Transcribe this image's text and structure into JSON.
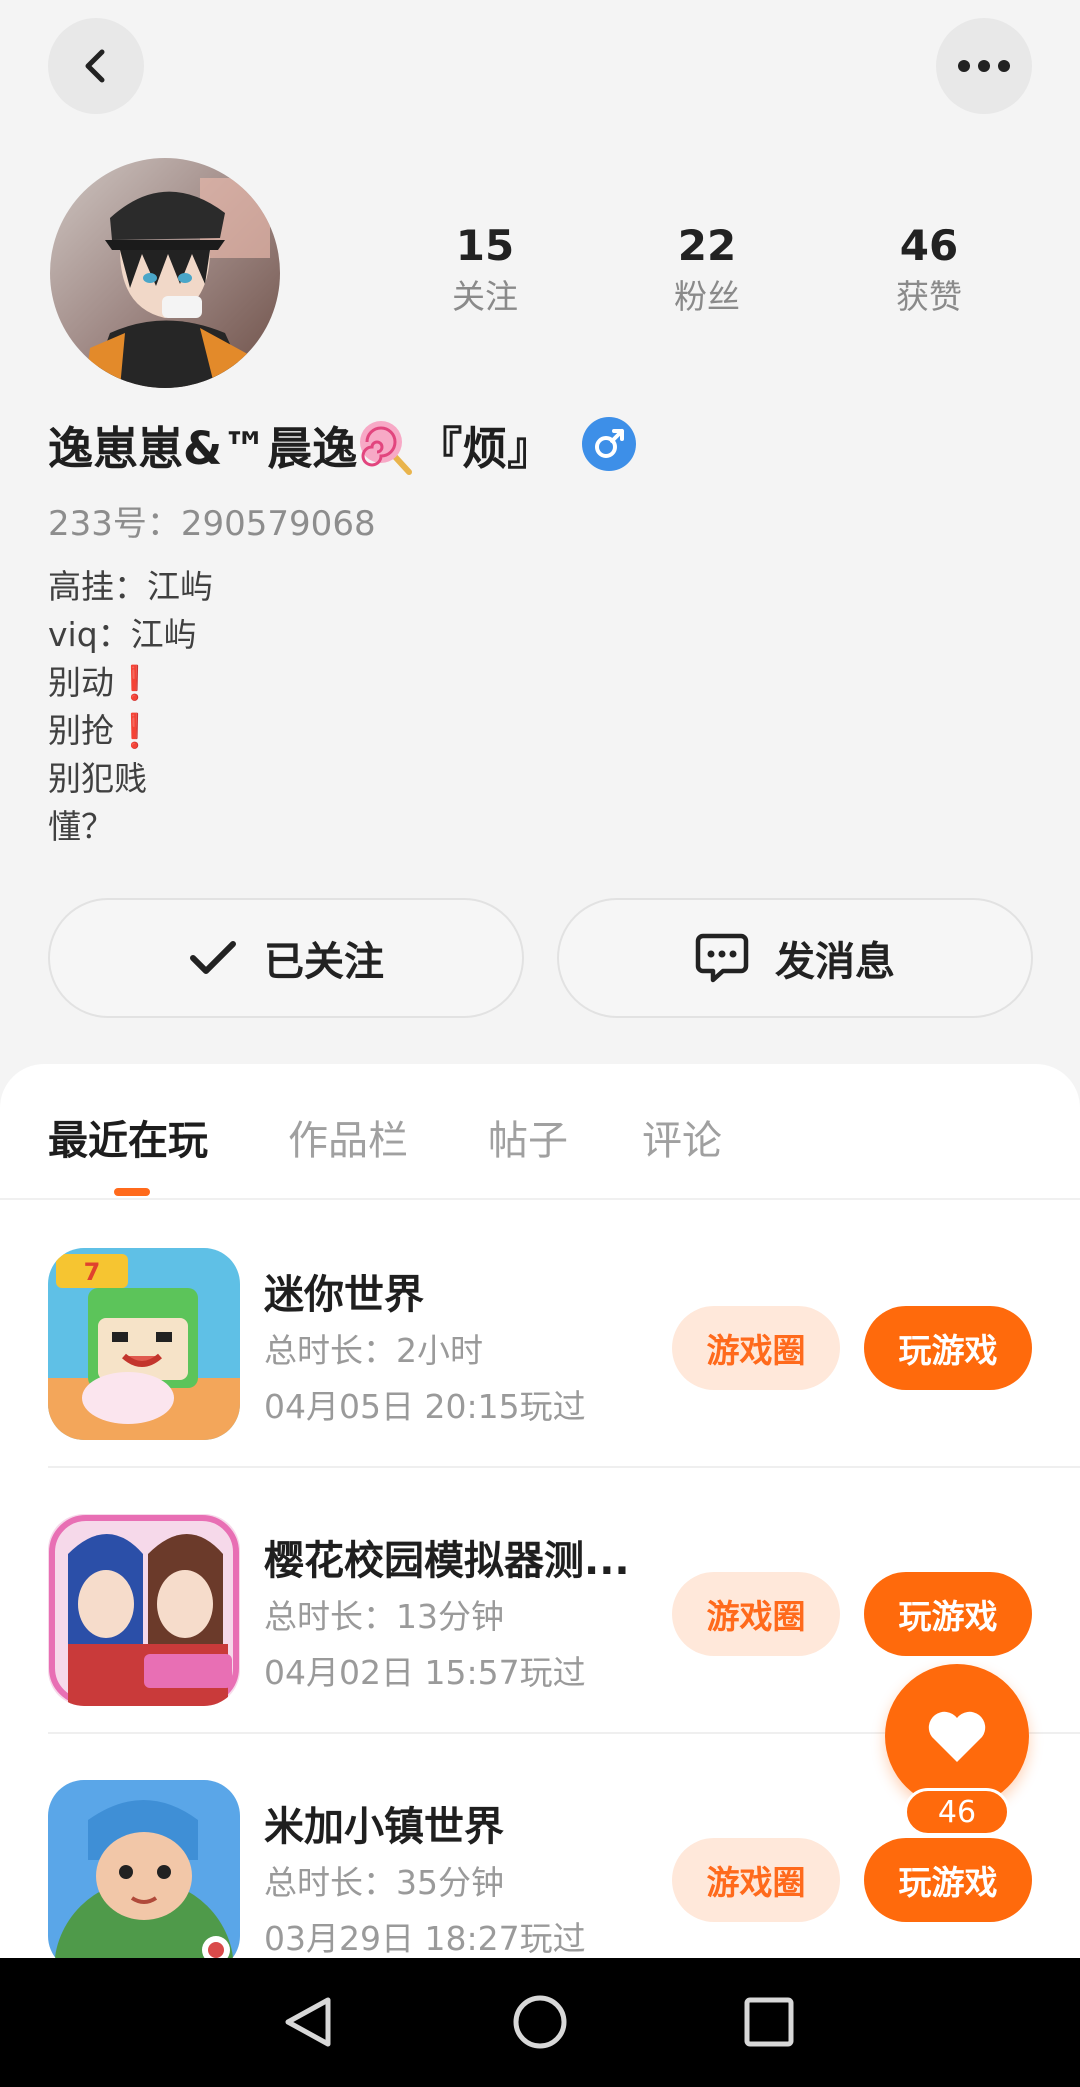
{
  "header": {
    "back_icon": "chevron-left-icon",
    "more_icon": "more-horizontal-icon"
  },
  "profile": {
    "stats": [
      {
        "value": "15",
        "label": "关注"
      },
      {
        "value": "22",
        "label": "粉丝"
      },
      {
        "value": "46",
        "label": "获赞"
      }
    ],
    "username_before_emoji": "逸崽崽&™晨逸",
    "username_after_emoji": "『烦』",
    "gender_icon": "male-icon",
    "uid": "233号：290579068",
    "bio": [
      {
        "text": "高挂：江屿",
        "mark": ""
      },
      {
        "text": "viq：江屿",
        "mark": ""
      },
      {
        "text": "别动",
        "mark": "❗"
      },
      {
        "text": "别抢",
        "mark": "❗"
      },
      {
        "text": "别犯贱",
        "mark": ""
      },
      {
        "text": "懂？",
        "mark": ""
      }
    ],
    "follow_label": "已关注",
    "message_label": "发消息"
  },
  "tabs": [
    {
      "label": "最近在玩",
      "active": true
    },
    {
      "label": "作品栏",
      "active": false
    },
    {
      "label": "帖子",
      "active": false
    },
    {
      "label": "评论",
      "active": false
    }
  ],
  "games": [
    {
      "name": "迷你世界",
      "duration": "总时长：2小时",
      "last_played": "04月05日 20:15玩过",
      "circle_label": "游戏圈",
      "play_label": "玩游戏"
    },
    {
      "name": "樱花校园模拟器测...",
      "duration": "总时长：13分钟",
      "last_played": "04月02日 15:57玩过",
      "circle_label": "游戏圈",
      "play_label": "玩游戏"
    },
    {
      "name": "米加小镇世界",
      "duration": "总时长：35分钟",
      "last_played": "03月29日 18:27玩过",
      "circle_label": "游戏圈",
      "play_label": "玩游戏"
    }
  ],
  "like_fab": {
    "icon": "heart-icon",
    "count": "46"
  },
  "colors": {
    "accent": "#ff6a0c",
    "accent_light": "#ffe8da",
    "gender_blue": "#3d8fe8"
  },
  "navbar": {
    "icons": [
      "nav-back-icon",
      "nav-home-icon",
      "nav-recents-icon"
    ]
  }
}
